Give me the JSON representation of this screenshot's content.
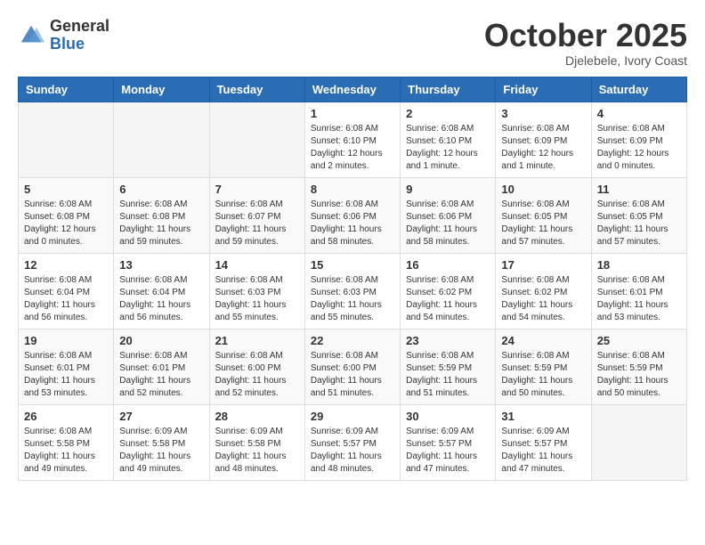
{
  "header": {
    "logo_general": "General",
    "logo_blue": "Blue",
    "month": "October 2025",
    "location": "Djelebele, Ivory Coast"
  },
  "weekdays": [
    "Sunday",
    "Monday",
    "Tuesday",
    "Wednesday",
    "Thursday",
    "Friday",
    "Saturday"
  ],
  "weeks": [
    [
      {
        "day": "",
        "info": ""
      },
      {
        "day": "",
        "info": ""
      },
      {
        "day": "",
        "info": ""
      },
      {
        "day": "1",
        "info": "Sunrise: 6:08 AM\nSunset: 6:10 PM\nDaylight: 12 hours\nand 2 minutes."
      },
      {
        "day": "2",
        "info": "Sunrise: 6:08 AM\nSunset: 6:10 PM\nDaylight: 12 hours\nand 1 minute."
      },
      {
        "day": "3",
        "info": "Sunrise: 6:08 AM\nSunset: 6:09 PM\nDaylight: 12 hours\nand 1 minute."
      },
      {
        "day": "4",
        "info": "Sunrise: 6:08 AM\nSunset: 6:09 PM\nDaylight: 12 hours\nand 0 minutes."
      }
    ],
    [
      {
        "day": "5",
        "info": "Sunrise: 6:08 AM\nSunset: 6:08 PM\nDaylight: 12 hours\nand 0 minutes."
      },
      {
        "day": "6",
        "info": "Sunrise: 6:08 AM\nSunset: 6:08 PM\nDaylight: 11 hours\nand 59 minutes."
      },
      {
        "day": "7",
        "info": "Sunrise: 6:08 AM\nSunset: 6:07 PM\nDaylight: 11 hours\nand 59 minutes."
      },
      {
        "day": "8",
        "info": "Sunrise: 6:08 AM\nSunset: 6:06 PM\nDaylight: 11 hours\nand 58 minutes."
      },
      {
        "day": "9",
        "info": "Sunrise: 6:08 AM\nSunset: 6:06 PM\nDaylight: 11 hours\nand 58 minutes."
      },
      {
        "day": "10",
        "info": "Sunrise: 6:08 AM\nSunset: 6:05 PM\nDaylight: 11 hours\nand 57 minutes."
      },
      {
        "day": "11",
        "info": "Sunrise: 6:08 AM\nSunset: 6:05 PM\nDaylight: 11 hours\nand 57 minutes."
      }
    ],
    [
      {
        "day": "12",
        "info": "Sunrise: 6:08 AM\nSunset: 6:04 PM\nDaylight: 11 hours\nand 56 minutes."
      },
      {
        "day": "13",
        "info": "Sunrise: 6:08 AM\nSunset: 6:04 PM\nDaylight: 11 hours\nand 56 minutes."
      },
      {
        "day": "14",
        "info": "Sunrise: 6:08 AM\nSunset: 6:03 PM\nDaylight: 11 hours\nand 55 minutes."
      },
      {
        "day": "15",
        "info": "Sunrise: 6:08 AM\nSunset: 6:03 PM\nDaylight: 11 hours\nand 55 minutes."
      },
      {
        "day": "16",
        "info": "Sunrise: 6:08 AM\nSunset: 6:02 PM\nDaylight: 11 hours\nand 54 minutes."
      },
      {
        "day": "17",
        "info": "Sunrise: 6:08 AM\nSunset: 6:02 PM\nDaylight: 11 hours\nand 54 minutes."
      },
      {
        "day": "18",
        "info": "Sunrise: 6:08 AM\nSunset: 6:01 PM\nDaylight: 11 hours\nand 53 minutes."
      }
    ],
    [
      {
        "day": "19",
        "info": "Sunrise: 6:08 AM\nSunset: 6:01 PM\nDaylight: 11 hours\nand 53 minutes."
      },
      {
        "day": "20",
        "info": "Sunrise: 6:08 AM\nSunset: 6:01 PM\nDaylight: 11 hours\nand 52 minutes."
      },
      {
        "day": "21",
        "info": "Sunrise: 6:08 AM\nSunset: 6:00 PM\nDaylight: 11 hours\nand 52 minutes."
      },
      {
        "day": "22",
        "info": "Sunrise: 6:08 AM\nSunset: 6:00 PM\nDaylight: 11 hours\nand 51 minutes."
      },
      {
        "day": "23",
        "info": "Sunrise: 6:08 AM\nSunset: 5:59 PM\nDaylight: 11 hours\nand 51 minutes."
      },
      {
        "day": "24",
        "info": "Sunrise: 6:08 AM\nSunset: 5:59 PM\nDaylight: 11 hours\nand 50 minutes."
      },
      {
        "day": "25",
        "info": "Sunrise: 6:08 AM\nSunset: 5:59 PM\nDaylight: 11 hours\nand 50 minutes."
      }
    ],
    [
      {
        "day": "26",
        "info": "Sunrise: 6:08 AM\nSunset: 5:58 PM\nDaylight: 11 hours\nand 49 minutes."
      },
      {
        "day": "27",
        "info": "Sunrise: 6:09 AM\nSunset: 5:58 PM\nDaylight: 11 hours\nand 49 minutes."
      },
      {
        "day": "28",
        "info": "Sunrise: 6:09 AM\nSunset: 5:58 PM\nDaylight: 11 hours\nand 48 minutes."
      },
      {
        "day": "29",
        "info": "Sunrise: 6:09 AM\nSunset: 5:57 PM\nDaylight: 11 hours\nand 48 minutes."
      },
      {
        "day": "30",
        "info": "Sunrise: 6:09 AM\nSunset: 5:57 PM\nDaylight: 11 hours\nand 47 minutes."
      },
      {
        "day": "31",
        "info": "Sunrise: 6:09 AM\nSunset: 5:57 PM\nDaylight: 11 hours\nand 47 minutes."
      },
      {
        "day": "",
        "info": ""
      }
    ]
  ]
}
